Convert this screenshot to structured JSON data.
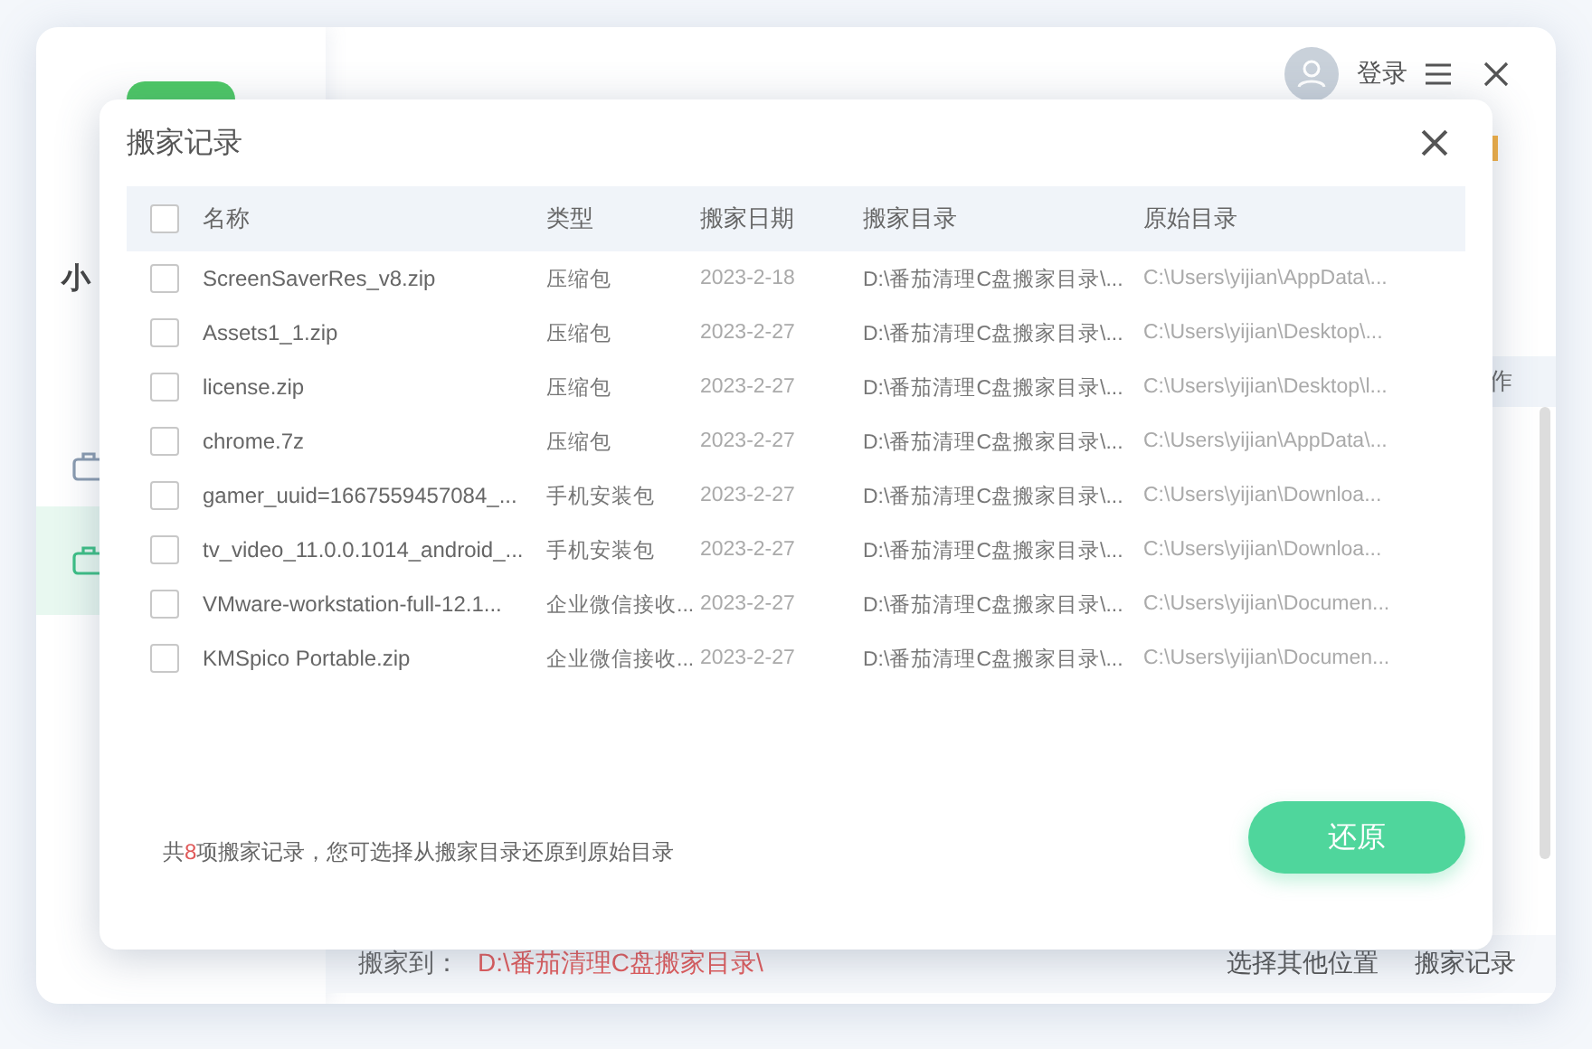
{
  "app": {
    "sidebar": {
      "title": "小",
      "items": [
        {
          "selected": false
        },
        {
          "selected": true
        }
      ]
    },
    "header": {
      "login": "登录"
    },
    "table_header_partial": "作",
    "bottom_bar": {
      "label": "搬家到：",
      "path": "D:\\番茄清理C盘搬家目录\\",
      "links": [
        "选择其他位置",
        "搬家记录"
      ]
    }
  },
  "dialog": {
    "title": "搬家记录",
    "header_checked": false,
    "columns": [
      "名称",
      "类型",
      "搬家日期",
      "搬家目录",
      "原始目录"
    ],
    "rows": [
      {
        "checked": false,
        "name": "ScreenSaverRes_v8.zip",
        "type": "压缩包",
        "date": "2023-2-18",
        "move_dir": "D:\\番茄清理C盘搬家目录\\...",
        "original_dir": "C:\\Users\\yijian\\AppData\\..."
      },
      {
        "checked": false,
        "name": "Assets1_1.zip",
        "type": "压缩包",
        "date": "2023-2-27",
        "move_dir": "D:\\番茄清理C盘搬家目录\\...",
        "original_dir": "C:\\Users\\yijian\\Desktop\\..."
      },
      {
        "checked": false,
        "name": "license.zip",
        "type": "压缩包",
        "date": "2023-2-27",
        "move_dir": "D:\\番茄清理C盘搬家目录\\...",
        "original_dir": "C:\\Users\\yijian\\Desktop\\l..."
      },
      {
        "checked": false,
        "name": "chrome.7z",
        "type": "压缩包",
        "date": "2023-2-27",
        "move_dir": "D:\\番茄清理C盘搬家目录\\...",
        "original_dir": "C:\\Users\\yijian\\AppData\\..."
      },
      {
        "checked": false,
        "name": "gamer_uuid=1667559457084_...",
        "type": "手机安装包",
        "date": "2023-2-27",
        "move_dir": "D:\\番茄清理C盘搬家目录\\...",
        "original_dir": "C:\\Users\\yijian\\Downloa..."
      },
      {
        "checked": false,
        "name": "tv_video_11.0.0.1014_android_...",
        "type": "手机安装包",
        "date": "2023-2-27",
        "move_dir": "D:\\番茄清理C盘搬家目录\\...",
        "original_dir": "C:\\Users\\yijian\\Downloa..."
      },
      {
        "checked": false,
        "name": "VMware-workstation-full-12.1...",
        "type": "企业微信接收...",
        "date": "2023-2-27",
        "move_dir": "D:\\番茄清理C盘搬家目录\\...",
        "original_dir": "C:\\Users\\yijian\\Documen..."
      },
      {
        "checked": false,
        "name": "KMSpico Portable.zip",
        "type": "企业微信接收...",
        "date": "2023-2-27",
        "move_dir": "D:\\番茄清理C盘搬家目录\\...",
        "original_dir": "C:\\Users\\yijian\\Documen..."
      }
    ],
    "footer": {
      "prefix": "共",
      "count": "8",
      "suffix": "项搬家记录，您可选择从搬家目录还原到原始目录"
    },
    "button": "还原"
  }
}
